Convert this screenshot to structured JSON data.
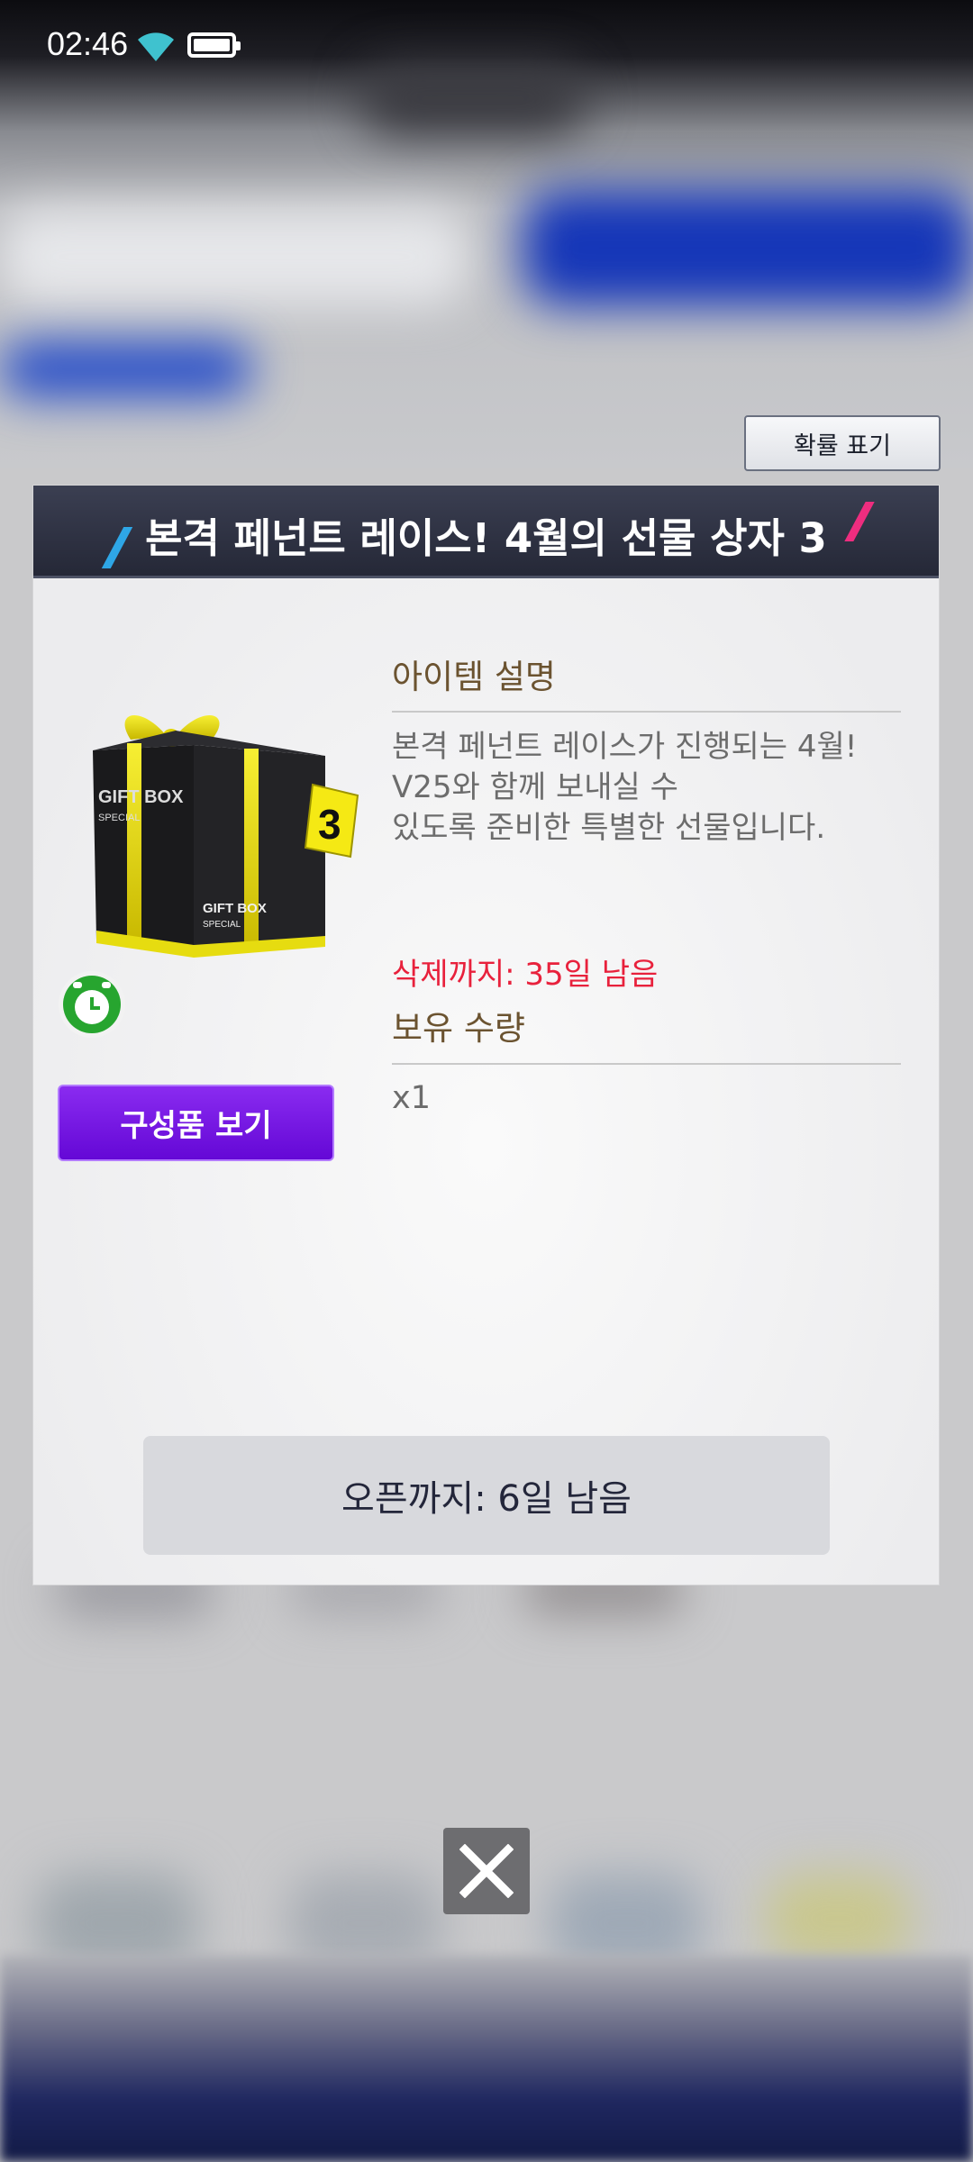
{
  "status_bar": {
    "time": "02:46"
  },
  "probability_button": {
    "label": "확률 표기"
  },
  "popup": {
    "title": "본격 페넌트 레이스! 4월의 선물 상자 3",
    "gift_image": {
      "box_text": "GIFT BOX",
      "box_subtext": "SPECIAL",
      "tag_number": "3"
    },
    "view_components_button": "구성품 보기",
    "item_description_heading": "아이템 설명",
    "item_description_lines": [
      "본격 페넌트 레이스가 진행되는 4월!",
      "V25와 함께 보내실 수",
      "있도록 준비한 특별한 선물입니다."
    ],
    "deletion_notice": "삭제까지: 35일 남음",
    "quantity_heading": "보유 수량",
    "quantity_value": "x1",
    "open_notice": "오픈까지: 6일 남음"
  },
  "colors": {
    "title_bar": "#2b2e3d",
    "button_purple": "#7a1ae6",
    "deletion_red": "#e8213c",
    "heading_brown": "#6b5330"
  }
}
